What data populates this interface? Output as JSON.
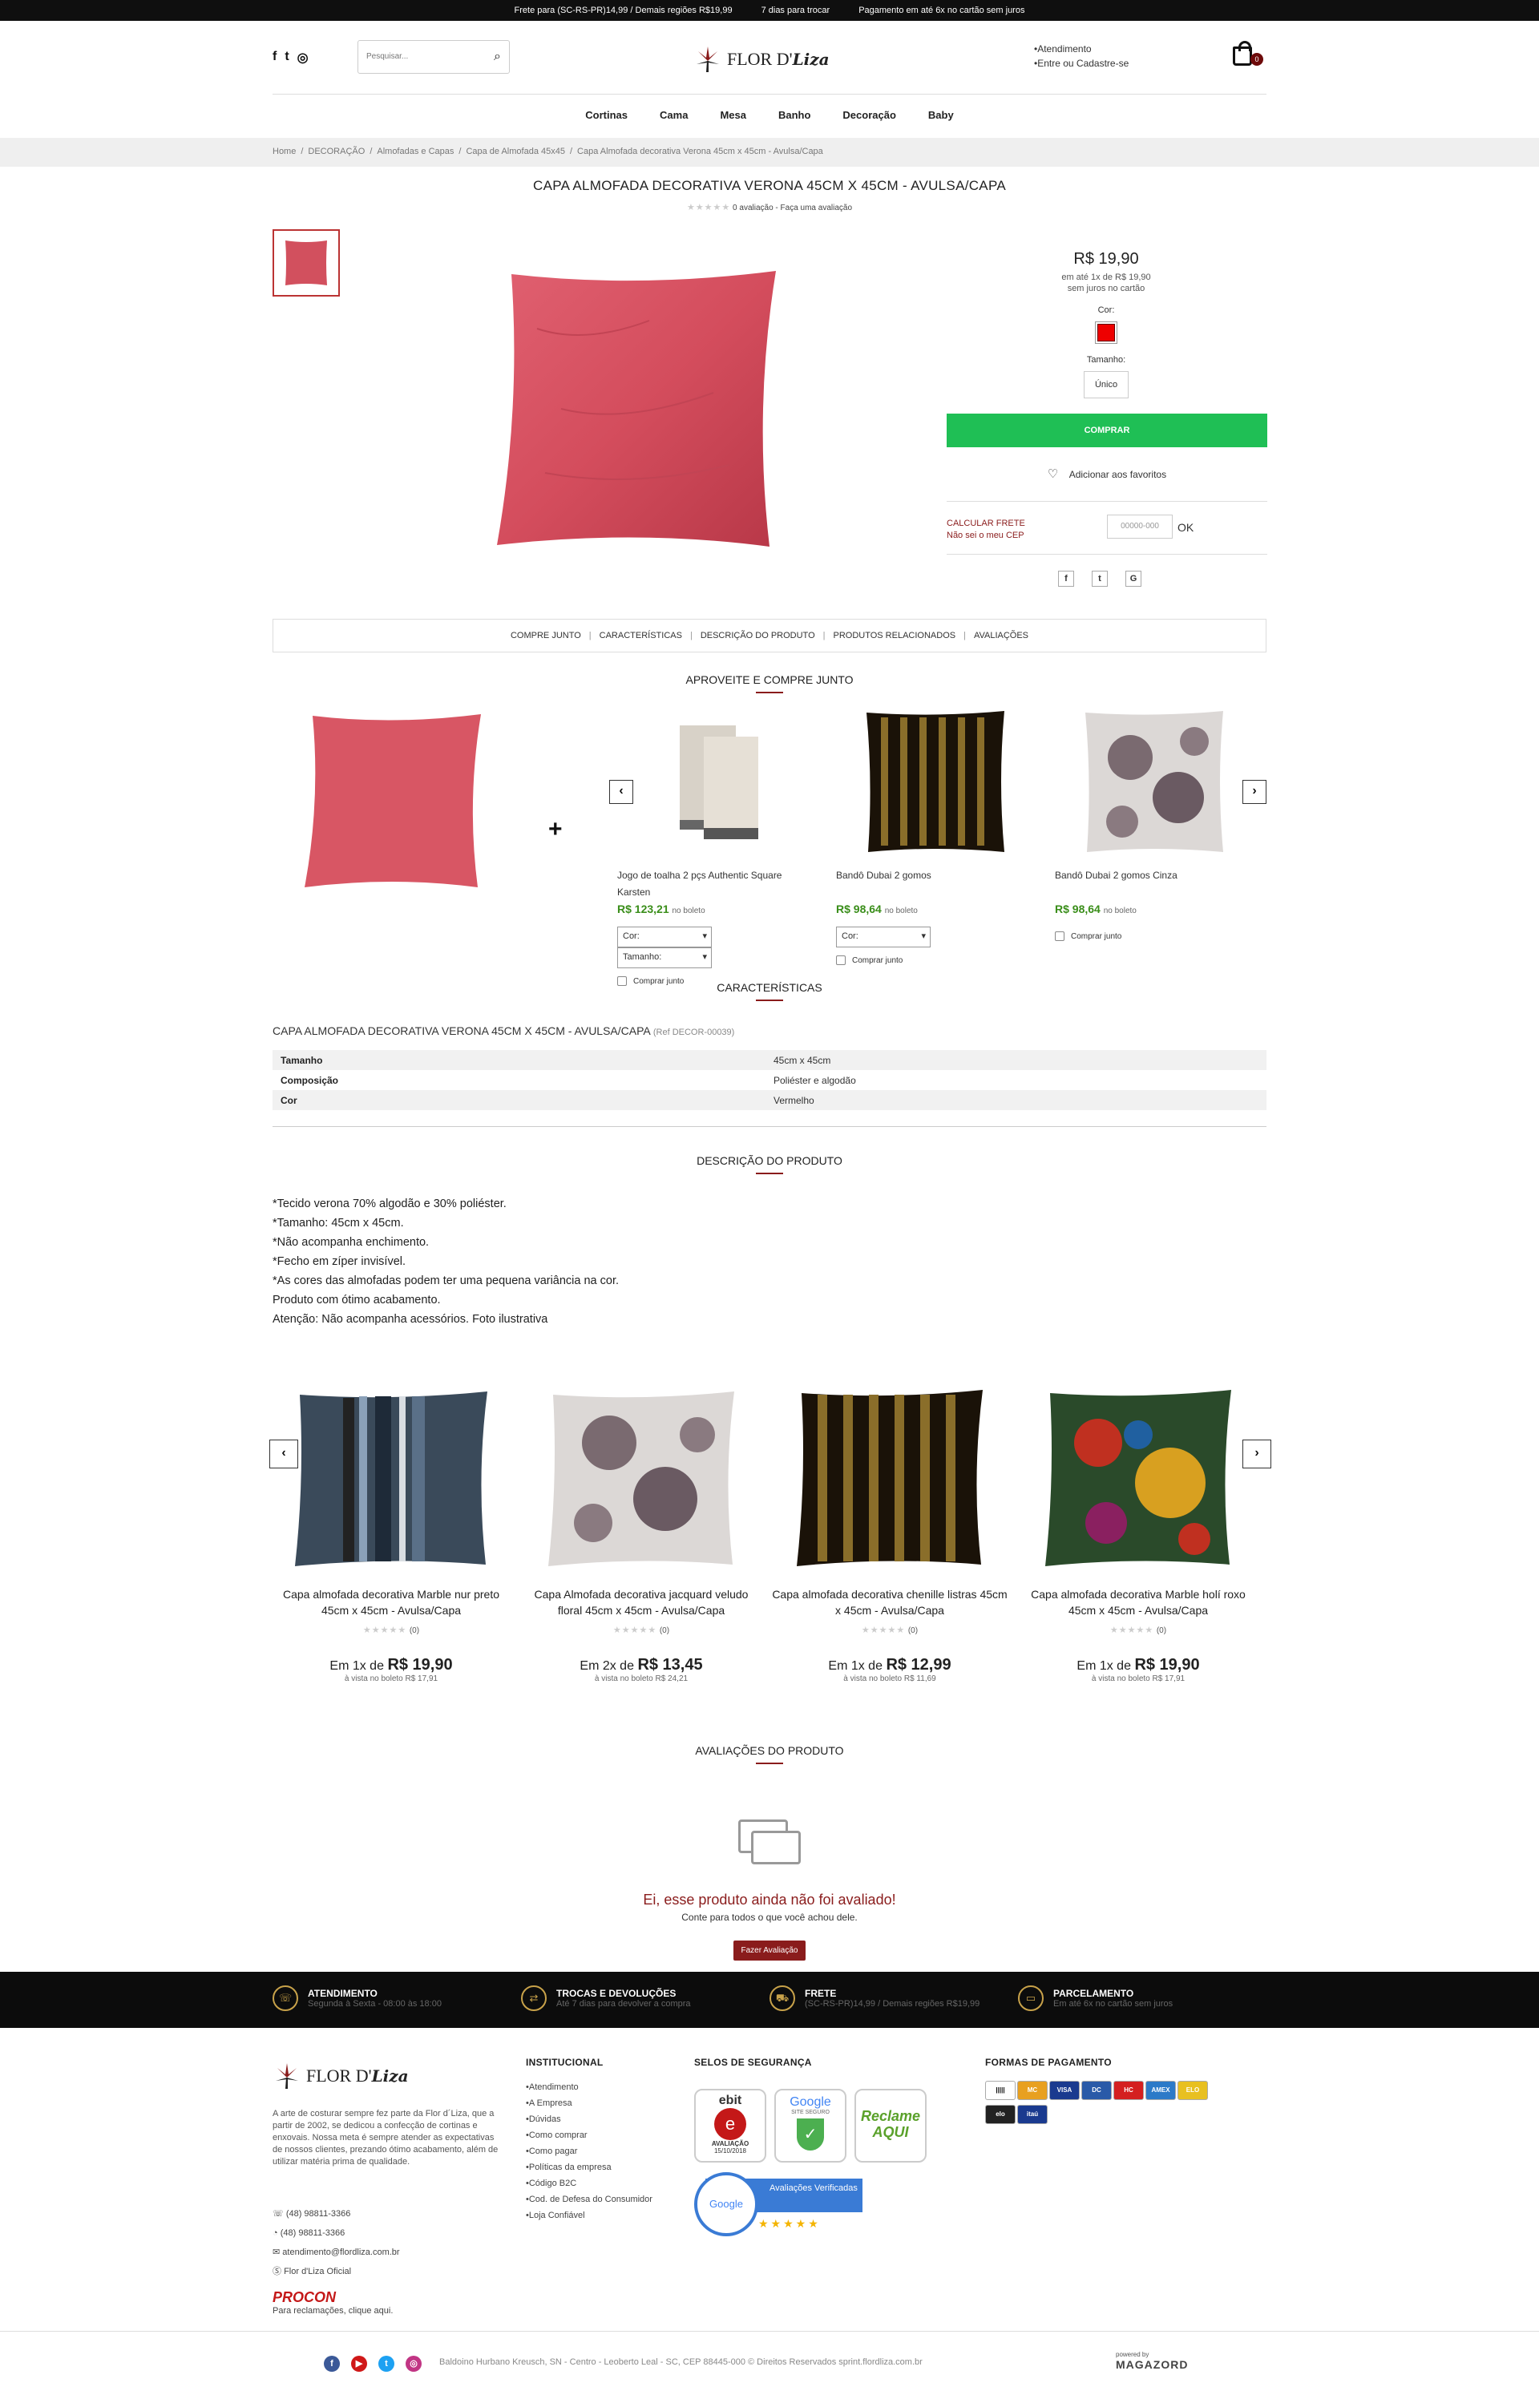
{
  "topbar": {
    "items": [
      "Frete para (SC-RS-PR)14,99 / Demais regiões R$19,99",
      "7 dias para trocar",
      "Pagamento em até 6x no cartão sem juros"
    ]
  },
  "header": {
    "search_placeholder": "Pesquisar...",
    "logo_text": "FLOR D'",
    "logo_italic": "Liza",
    "links": [
      "Atendimento",
      "Entre ou Cadastre-se"
    ],
    "cart_count": "0"
  },
  "nav": [
    "Cortinas",
    "Cama",
    "Mesa",
    "Banho",
    "Decoração",
    "Baby"
  ],
  "breadcrumb": [
    "Home",
    "/",
    "DECORAÇÃO",
    "/",
    "Almofadas e Capas",
    "/",
    "Capa de Almofada 45x45",
    "/",
    "Capa Almofada decorativa Verona 45cm x 45cm - Avulsa/Capa"
  ],
  "product": {
    "title": "CAPA ALMOFADA DECORATIVA VERONA 45CM X 45CM - AVULSA/CAPA",
    "stars": "★★★★★",
    "rating_text": "0 avaliação - Faça uma avaliação",
    "price": "R$ 19,90",
    "installments": "em até 1x de R$ 19,90",
    "installments2": "sem juros no cartão",
    "color_label": "Cor:",
    "color_value": "#e01010",
    "size_label": "Tamanho:",
    "size_value": "Único",
    "buy_label": "COMPRAR",
    "fav_label": "Adicionar aos favoritos",
    "freight_title": "CALCULAR FRETE",
    "freight_link": "Não sei o meu CEP",
    "cep_placeholder": "00000-000",
    "ok_label": "OK",
    "share": [
      "f",
      "t",
      "G"
    ]
  },
  "tabs": [
    "COMPRE JUNTO",
    "CARACTERÍSTICAS",
    "DESCRIÇÃO DO PRODUTO",
    "PRODUTOS RELACIONADOS",
    "AVALIAÇÕES"
  ],
  "compre_junto": {
    "title": "APROVEITE E COMPRE JUNTO",
    "plus": "+",
    "items": [
      {
        "name": "Jogo de toalha 2 pçs Authentic Square Karsten",
        "price": "R$ 123,21",
        "suffix": "no boleto",
        "sel1": "Cor:",
        "sel2": "Tamanho:",
        "check": "Comprar junto"
      },
      {
        "name": "Bandô Dubai 2 gomos",
        "price": "R$ 98,64",
        "suffix": "no boleto",
        "sel1": "Cor:",
        "check": "Comprar junto"
      },
      {
        "name": "Bandô Dubai 2 gomos Cinza",
        "price": "R$ 98,64",
        "suffix": "no boleto",
        "check": "Comprar junto"
      }
    ]
  },
  "characteristics": {
    "title": "CARACTERÍSTICAS",
    "name": "CAPA ALMOFADA DECORATIVA VERONA 45CM X 45CM - AVULSA/CAPA",
    "ref": "(Ref DECOR-00039)",
    "rows": [
      {
        "k": "Tamanho",
        "v": "45cm x 45cm"
      },
      {
        "k": "Composição",
        "v": "Poliéster e algodão"
      },
      {
        "k": "Cor",
        "v": "Vermelho"
      }
    ]
  },
  "description": {
    "title": "DESCRIÇÃO DO PRODUTO",
    "lines": [
      "*Tecido verona 70% algodão e 30% poliéster.",
      "*Tamanho: 45cm x 45cm.",
      "*Não acompanha enchimento.",
      "*Fecho em zíper invisível.",
      "*As cores das almofadas podem ter uma pequena variância na cor.",
      "Produto com ótimo acabamento.",
      "Atenção: Não acompanha acessórios. Foto ilustrativa"
    ]
  },
  "related": [
    {
      "name": "Capa almofada decorativa Marble nur preto 45cm x 45cm - Avulsa/Capa",
      "count": "(0)",
      "prefix": "Em 1x de",
      "price": "R$ 19,90",
      "sub": "à vista no boleto R$ 17,91"
    },
    {
      "name": "Capa Almofada decorativa jacquard veludo floral 45cm x 45cm - Avulsa/Capa",
      "count": "(0)",
      "prefix": "Em 2x de",
      "price": "R$ 13,45",
      "sub": "à vista no boleto R$ 24,21"
    },
    {
      "name": "Capa almofada decorativa chenille listras 45cm x 45cm - Avulsa/Capa",
      "count": "(0)",
      "prefix": "Em 1x de",
      "price": "R$ 12,99",
      "sub": "à vista no boleto R$ 11,69"
    },
    {
      "name": "Capa almofada decorativa Marble holí roxo 45cm x 45cm - Avulsa/Capa",
      "count": "(0)",
      "prefix": "Em 1x de",
      "price": "R$ 19,90",
      "sub": "à vista no boleto R$ 17,91"
    }
  ],
  "reviews": {
    "title": "AVALIAÇÕES DO PRODUTO",
    "empty_title": "Ei, esse produto ainda não foi avaliado!",
    "empty_sub": "Conte para todos o que você achou dele.",
    "button": "Fazer Avaliação"
  },
  "infobar": [
    {
      "icon": "☏",
      "title": "ATENDIMENTO",
      "sub": "Segunda à Sexta - 08:00 às 18:00"
    },
    {
      "icon": "⇄",
      "title": "TROCAS E DEVOLUÇÕES",
      "sub": "Até 7 dias para devolver a compra"
    },
    {
      "icon": "⛟",
      "title": "FRETE",
      "sub": "(SC-RS-PR)14,99 / Demais regiões R$19,99"
    },
    {
      "icon": "▭",
      "title": "PARCELAMENTO",
      "sub": "Em até 6x no cartão sem juros"
    }
  ],
  "footer": {
    "about": "A arte de costurar sempre fez parte da Flor d´Liza, que a partir de 2002, se dedicou a confecção de cortinas e enxovais. Nossa meta é sempre atender as expectativas de nossos clientes, prezando ótimo acabamento, além de utilizar matéria prima de qualidade.",
    "contacts": [
      "(48) 98811-3366",
      "(48) 98811-3366",
      "atendimento@flordliza.com.br",
      "Flor d'Liza Oficial"
    ],
    "procon": "PROCON",
    "procon_sub": "Para reclamações, clique aqui.",
    "inst_title": "INSTITUCIONAL",
    "inst_links": [
      "Atendimento",
      "A Empresa",
      "Dúvidas",
      "Como comprar",
      "Como pagar",
      "Políticas da empresa",
      "Código B2C",
      "Cod. de Defesa do Consumidor",
      "Loja Confiável"
    ],
    "seals_title": "SELOS DE SEGURANÇA",
    "seal_ebit": "ebit",
    "seal_ebit_sub": "AVALIAÇÃO",
    "seal_ebit_date": "15/10/2018",
    "seal_google": "Google",
    "seal_google_sub": "SITE SEGURO",
    "seal_reclame": "Reclame AQUI",
    "seal_gr": "Google",
    "seal_gr_sub": "Avaliações Verificadas",
    "seal_gr_stars": "★★★★★",
    "pay_title": "FORMAS DE PAGAMENTO",
    "pay_methods": [
      {
        "label": "|||||",
        "color": "#ffffff"
      },
      {
        "label": "MC",
        "color": "#e8a020"
      },
      {
        "label": "VISA",
        "color": "#1a3a8f"
      },
      {
        "label": "DC",
        "color": "#2a5aa8"
      },
      {
        "label": "HC",
        "color": "#d42020"
      },
      {
        "label": "AMEX",
        "color": "#2c7ac8"
      },
      {
        "label": "ELO",
        "color": "#e8c020"
      },
      {
        "label": "elo",
        "color": "#222222"
      },
      {
        "label": "itaú",
        "color": "#1a3a8f"
      }
    ],
    "address": "Baldoino Hurbano Kreusch, SN - Centro - Leoberto Leal - SC, CEP 88445-000 © Direitos Reservados sprint.flordliza.com.br",
    "powered": "powered by",
    "magazord": "MAGAZORD"
  }
}
